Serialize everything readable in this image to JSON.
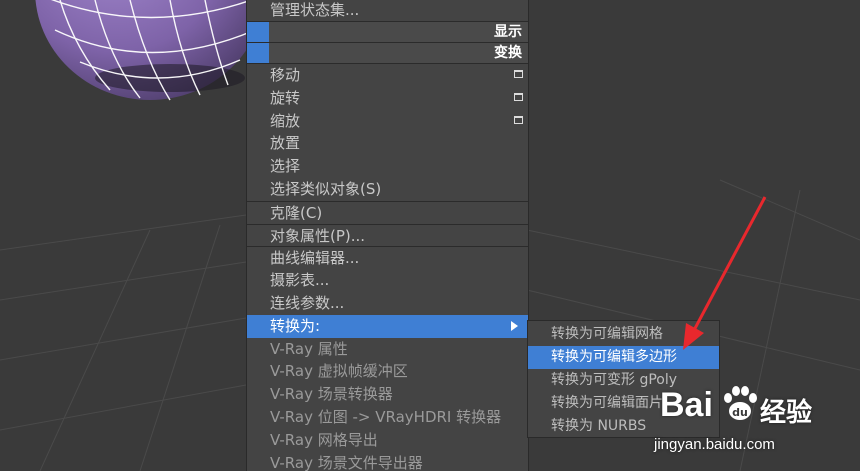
{
  "quad_menu": {
    "items_top": [
      {
        "label": "管理状态集..."
      }
    ],
    "headers": [
      {
        "label": "显示"
      },
      {
        "label": "变换"
      }
    ],
    "transform_items": [
      {
        "label": "移动",
        "has_box": true
      },
      {
        "label": "旋转",
        "has_box": true
      },
      {
        "label": "缩放",
        "has_box": true
      },
      {
        "label": "放置"
      },
      {
        "label": "选择"
      },
      {
        "label": "选择类似对象(S)"
      }
    ],
    "clone": "克隆(C)",
    "object_properties": "对象属性(P)...",
    "editors": [
      "曲线编辑器...",
      "摄影表...",
      "连线参数..."
    ],
    "convert_to": "转换为:",
    "vray_items": [
      "V-Ray 属性",
      "V-Ray 虚拟帧缓冲区",
      "V-Ray 场景转换器",
      "V-Ray 位图 -> VRayHDRI 转换器",
      "V-Ray 网格导出",
      "V-Ray 场景文件导出器"
    ]
  },
  "submenu": {
    "items": [
      {
        "label": "转换为可编辑网格",
        "active": false
      },
      {
        "label": "转换为可编辑多边形",
        "active": true
      },
      {
        "label": "转换为可变形 gPoly",
        "active": false
      },
      {
        "label": "转换为可编辑面片",
        "active": false
      },
      {
        "label": "转换为 NURBS",
        "active": false
      }
    ]
  },
  "watermark": {
    "brand_left": "Bai",
    "brand_right": "经验",
    "url": "jingyan.baidu.com"
  },
  "colors": {
    "menu_bg": "#444444",
    "highlight": "#3f7fd4",
    "sphere": "#7e63a8",
    "annotation_arrow": "#e8282d"
  }
}
